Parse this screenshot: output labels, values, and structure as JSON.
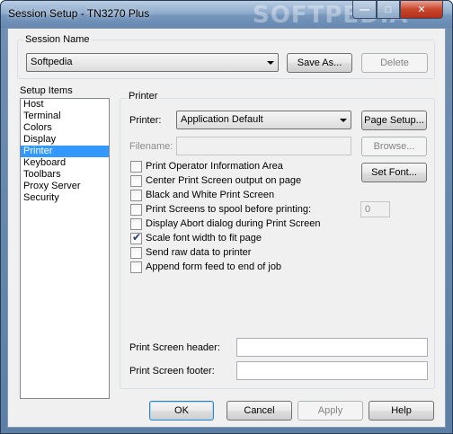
{
  "window": {
    "title": "Session Setup - TN3270 Plus",
    "watermark": "SOFTPEDIA",
    "minimize_glyph": "—",
    "maximize_glyph": "□",
    "close_glyph": "✕"
  },
  "session": {
    "group_label": "Session Name",
    "selected": "Softpedia",
    "save_as_label": "Save As...",
    "delete_label": "Delete"
  },
  "setup_items": {
    "label": "Setup Items",
    "items": [
      {
        "label": "Host"
      },
      {
        "label": "Terminal"
      },
      {
        "label": "Colors"
      },
      {
        "label": "Display"
      },
      {
        "label": "Printer",
        "selected": true
      },
      {
        "label": "Keyboard"
      },
      {
        "label": "Toolbars"
      },
      {
        "label": "Proxy Server"
      },
      {
        "label": "Security"
      }
    ]
  },
  "printer": {
    "group_label": "Printer",
    "printer_label": "Printer:",
    "printer_value": "Application Default",
    "page_setup_label": "Page Setup...",
    "filename_label": "Filename:",
    "filename_value": "",
    "browse_label": "Browse...",
    "set_font_label": "Set Font...",
    "spool_value": "0",
    "options": [
      {
        "label": "Print Operator Information Area",
        "checked": false
      },
      {
        "label": "Center Print Screen output on page",
        "checked": false
      },
      {
        "label": "Black and White Print Screen",
        "checked": false
      },
      {
        "label": "Print Screens to spool before printing:",
        "checked": false
      },
      {
        "label": "Display Abort dialog during Print Screen",
        "checked": false
      },
      {
        "label": "Scale font width to fit page",
        "checked": true
      },
      {
        "label": "Send raw data to printer",
        "checked": false
      },
      {
        "label": "Append form feed to end of job",
        "checked": false
      }
    ],
    "header_label": "Print Screen header:",
    "header_value": "",
    "footer_label": "Print Screen footer:",
    "footer_value": ""
  },
  "footer": {
    "ok_label": "OK",
    "cancel_label": "Cancel",
    "apply_label": "Apply",
    "help_label": "Help"
  }
}
